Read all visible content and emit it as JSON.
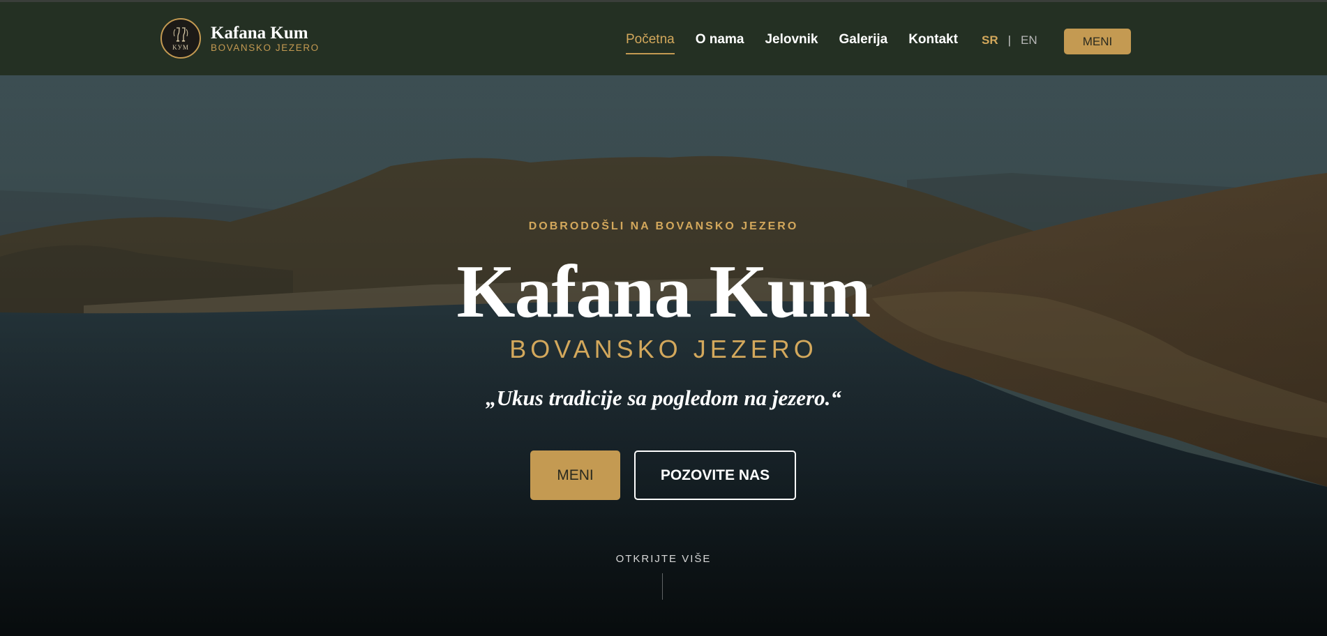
{
  "brand": {
    "name": "Kafana Kum",
    "subtitle": "BOVANSKO JEZERO",
    "logo_text": "KУМ"
  },
  "nav": {
    "items": [
      {
        "label": "Početna",
        "active": true
      },
      {
        "label": "O nama",
        "active": false
      },
      {
        "label": "Jelovnik",
        "active": false
      },
      {
        "label": "Galerija",
        "active": false
      },
      {
        "label": "Kontakt",
        "active": false
      }
    ]
  },
  "lang": {
    "sr": "SR",
    "separator": "|",
    "en": "EN",
    "active": "SR"
  },
  "header_button": {
    "label": "MENI"
  },
  "hero": {
    "eyebrow": "DOBRODOŠLI NA BOVANSKO JEZERO",
    "title": "Kafana Kum",
    "subtitle": "BOVANSKO JEZERO",
    "tagline": "„Ukus tradicije sa pogledom na jezero.“",
    "primary_button": "MENI",
    "secondary_button": "POZOVITE NAS",
    "scroll_hint": "OTKRIJTE VIŠE",
    "background": "aerial photo of lake with forested hills"
  },
  "colors": {
    "accent": "#c49a52",
    "header_bg": "#243023",
    "text": "#ffffff"
  }
}
